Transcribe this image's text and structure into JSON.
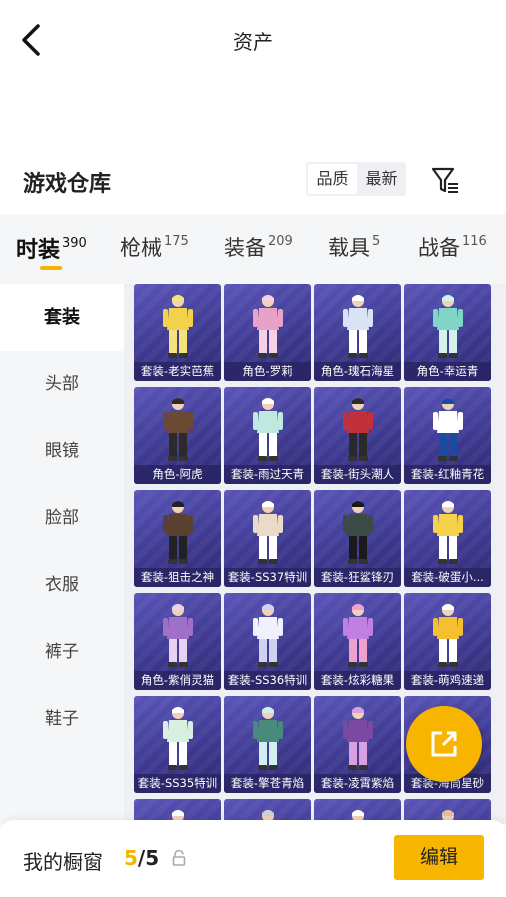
{
  "header": {
    "title": "资产"
  },
  "section": {
    "title": "游戏仓库",
    "sort_options": [
      "品质",
      "最新"
    ]
  },
  "tabs": [
    {
      "label": "时装",
      "count": "390"
    },
    {
      "label": "枪械",
      "count": "175"
    },
    {
      "label": "装备",
      "count": "209"
    },
    {
      "label": "载具",
      "count": "5"
    },
    {
      "label": "战备",
      "count": "116"
    }
  ],
  "sidebar": [
    "套装",
    "头部",
    "眼镜",
    "脸部",
    "衣服",
    "裤子",
    "鞋子"
  ],
  "items": [
    "套装-老实芭蕉",
    "角色-罗莉",
    "角色-瑰石海星",
    "角色-幸运青",
    "角色-阿虎",
    "套装-雨过天青",
    "套装-街头潮人",
    "套装-红釉青花",
    "套装-狙击之神",
    "套装-SS37特训",
    "套装-狂鲨锋刃",
    "套装-破蛋小...",
    "角色-紫俏灵猫",
    "套装-SS36特训",
    "套装-炫彩糖果",
    "套装-萌鸡速递",
    "套装-SS35特训",
    "套装-擎苍青焰",
    "套装-凌霄紫焰",
    "套装-海筒星砂",
    "",
    "",
    "",
    ""
  ],
  "bottom": {
    "label": "我的橱窗",
    "current": "5",
    "total": "/5",
    "edit": "编辑"
  },
  "colors": {
    "accent": "#f5b400",
    "card": "#4a45a4"
  },
  "icons": [
    "back-arrow-icon",
    "filter-icon",
    "external-link-icon",
    "lock-icon"
  ]
}
